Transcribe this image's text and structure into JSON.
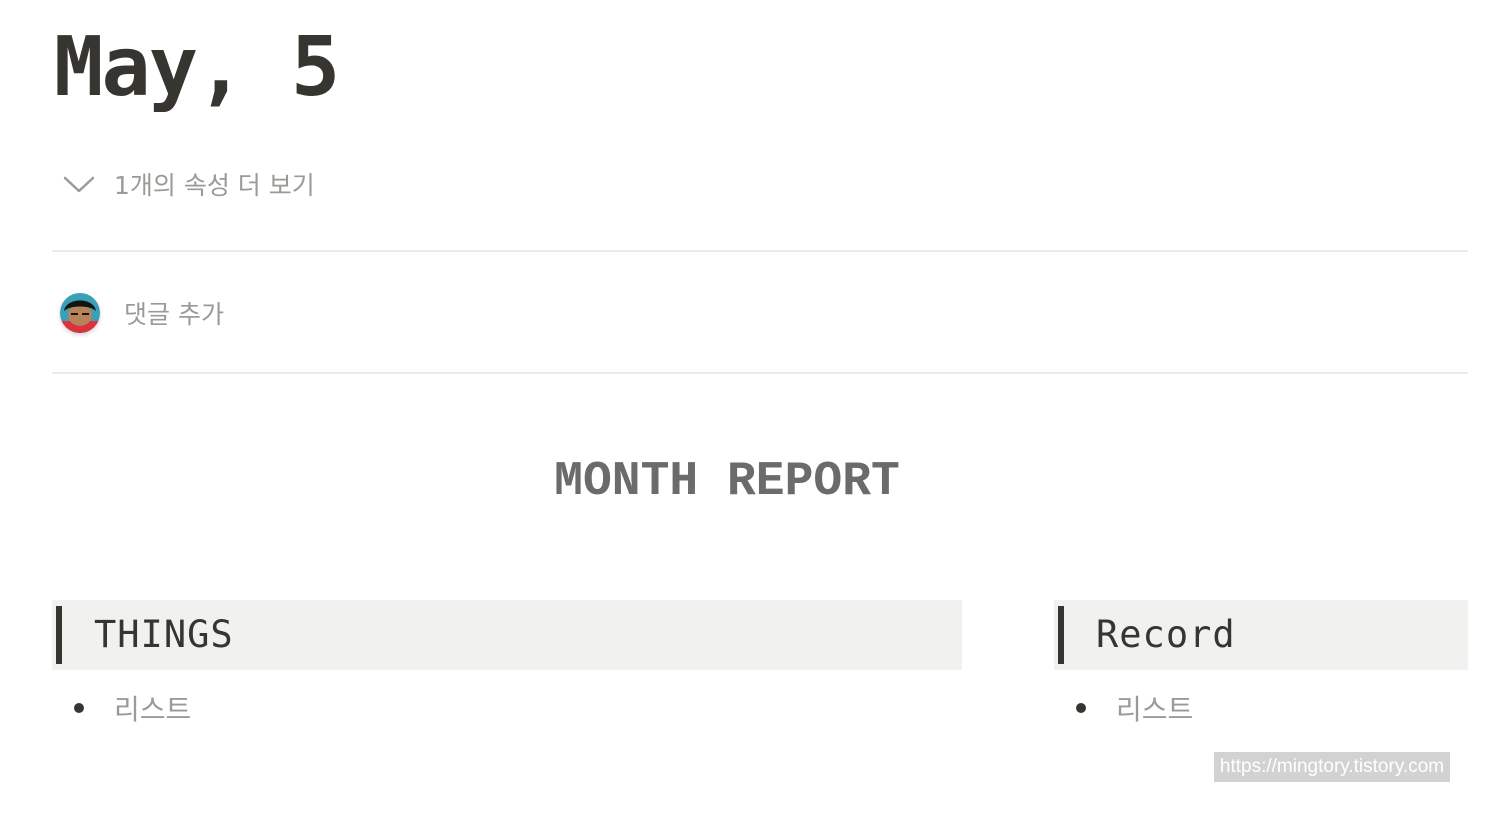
{
  "page": {
    "title": "May, 5"
  },
  "properties": {
    "toggle_label": "1개의 속성 더 보기",
    "toggle_icon": "chevron-down-icon"
  },
  "comments": {
    "placeholder": "댓글 추가",
    "avatar_icon": "user-avatar"
  },
  "content": {
    "report_title": "MONTH REPORT",
    "columns": [
      {
        "heading": "THINGS",
        "items": [
          "리스트"
        ]
      },
      {
        "heading": "Record",
        "items": [
          "리스트"
        ]
      }
    ]
  },
  "watermark": {
    "text": "https://mingtory.tistory.com"
  },
  "colors": {
    "text": "#37352f",
    "muted": "#9b9a97",
    "callout_bg": "#f1f1ef",
    "divider": "#ebebea"
  }
}
